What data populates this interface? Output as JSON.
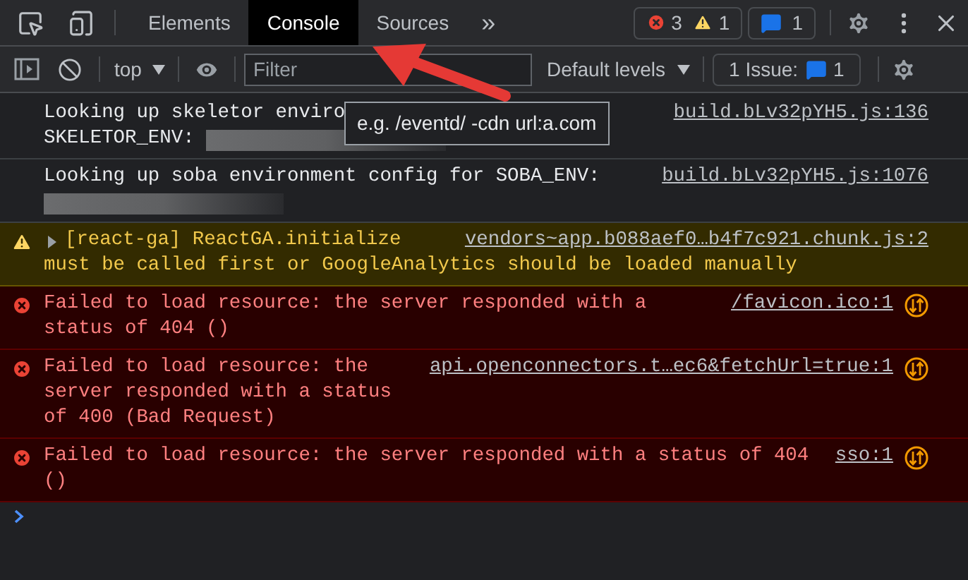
{
  "tabs": [
    {
      "label": "Elements",
      "selected": false
    },
    {
      "label": "Console",
      "selected": true
    },
    {
      "label": "Sources",
      "selected": false
    }
  ],
  "more_tabs": "»",
  "counters": {
    "errors": "3",
    "warnings": "1",
    "messages": "1"
  },
  "toolbar": {
    "context": "top",
    "filter_placeholder": "Filter",
    "levels": "Default levels",
    "issues_label": "1 Issue:",
    "issues_count": "1"
  },
  "tooltip": "e.g. /eventd/ -cdn url:a.com",
  "messages": [
    {
      "kind": "log",
      "lines": [
        {
          "text": "Looking up skeletor enviro",
          "redacted": false
        },
        {
          "text": "SKELETOR_ENV:",
          "redacted": true
        }
      ],
      "source": "build.bLv32pYH5.js:136"
    },
    {
      "kind": "log",
      "lines": [
        {
          "text": "Looking up soba environment config for SOBA_ENV:",
          "redacted": false
        },
        {
          "redacted": true
        }
      ],
      "source": "build.bLv32pYH5.js:1076"
    },
    {
      "kind": "warning",
      "expandable": true,
      "lines": [
        {
          "text": "[react-ga] ReactGA.initialize",
          "redacted": false
        },
        {
          "text": "must be called first or GoogleAnalytics should be loaded manually",
          "redacted": false
        }
      ],
      "source": "vendors~app.b088aef0…b4f7c921.chunk.js:2"
    },
    {
      "kind": "error",
      "text": "Failed to load resource: the server responded with a status of 404 ()",
      "source": "/favicon.ico:1",
      "network": true
    },
    {
      "kind": "error",
      "text": "Failed to load resource: the server responded with a status of 400 (Bad Request)",
      "source": "api.openconnectors.t…ec6&fetchUrl=true:1",
      "network": true
    },
    {
      "kind": "error",
      "text": "Failed to load resource: the server responded with a status of 404 ()",
      "source": "sso:1",
      "network": true
    }
  ]
}
